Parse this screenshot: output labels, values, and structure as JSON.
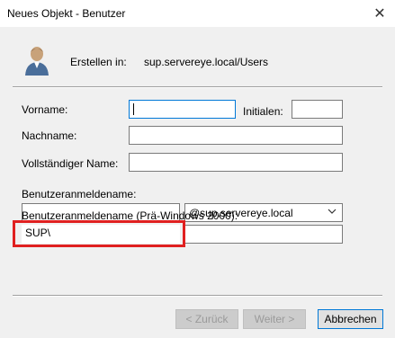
{
  "window": {
    "title": "Neues Objekt - Benutzer",
    "close_glyph": "✕"
  },
  "header": {
    "create_in_label": "Erstellen in:",
    "create_in_path": "sup.servereye.local/Users",
    "icon": "user-icon"
  },
  "form": {
    "vorname_label": "Vorname:",
    "vorname_value": "",
    "initialen_label": "Initialen:",
    "initialen_value": "",
    "nachname_label": "Nachname:",
    "nachname_value": "",
    "vollname_label": "Vollständiger Name:",
    "vollname_value": "",
    "logon_label": "Benutzeranmeldename:",
    "logon_value": "",
    "domain_selected": "@sup.servereye.local",
    "pre2000_label": "Benutzeranmeldename (Prä-Windows 2000):",
    "pre2000_prefix": "SUP\\",
    "pre2000_value": ""
  },
  "buttons": {
    "back": "< Zurück",
    "next": "Weiter >",
    "cancel": "Abbrechen"
  },
  "colors": {
    "highlight": "#e02020",
    "focus": "#0078d7"
  }
}
